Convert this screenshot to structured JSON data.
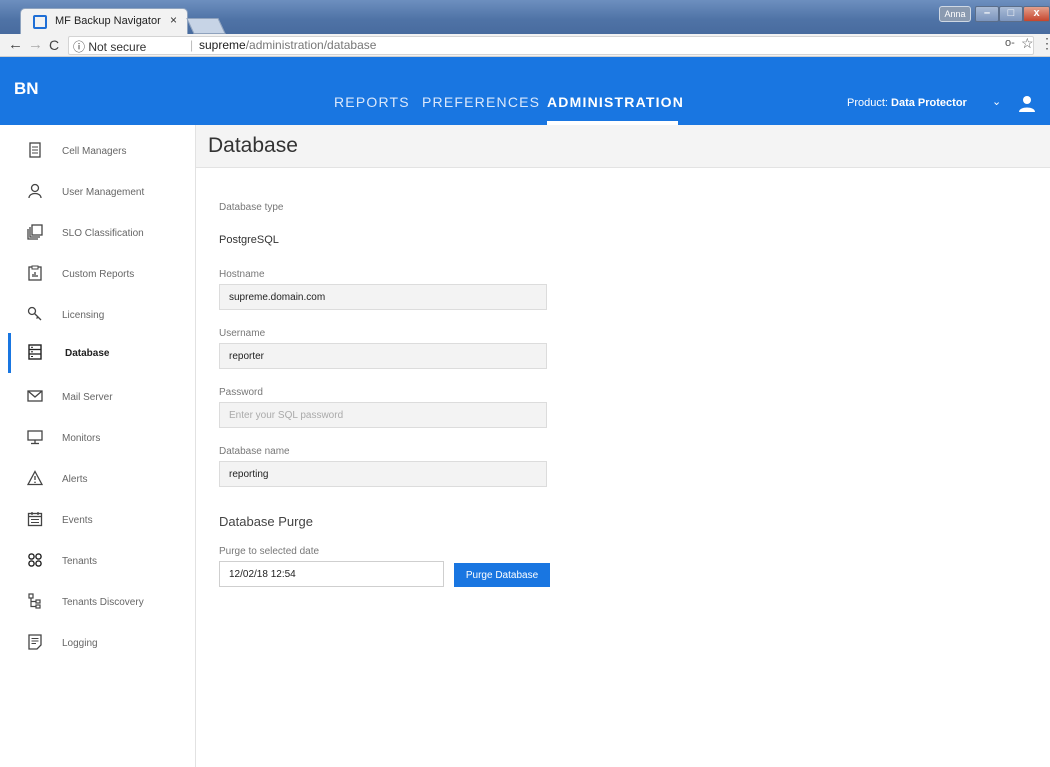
{
  "browser": {
    "tab_title": "MF Backup Navigator",
    "tab_close": "×",
    "user_label": "Anna",
    "security_label": "ⓘ Not secure",
    "url_host": "supreme",
    "url_path": "/administration/database"
  },
  "header": {
    "logo": "BN",
    "nav": [
      "REPORTS",
      "PREFERENCES",
      "ADMINISTRATION"
    ],
    "active_nav": "ADMINISTRATION",
    "product_label": "Product:",
    "product_value": "Data Protector"
  },
  "sidebar": {
    "items": [
      {
        "label": "Cell Managers",
        "icon": "document-icon"
      },
      {
        "label": "User Management",
        "icon": "user-icon"
      },
      {
        "label": "SLO Classification",
        "icon": "layers-icon"
      },
      {
        "label": "Custom Reports",
        "icon": "clipboard-chart-icon"
      },
      {
        "label": "Licensing",
        "icon": "key-icon"
      },
      {
        "label": "Database",
        "icon": "database-icon"
      },
      {
        "label": "Mail Server",
        "icon": "mail-icon"
      },
      {
        "label": "Monitors",
        "icon": "monitor-icon"
      },
      {
        "label": "Alerts",
        "icon": "warning-icon"
      },
      {
        "label": "Events",
        "icon": "calendar-icon"
      },
      {
        "label": "Tenants",
        "icon": "group-icon"
      },
      {
        "label": "Tenants Discovery",
        "icon": "hierarchy-icon"
      },
      {
        "label": "Logging",
        "icon": "log-icon"
      }
    ],
    "active_item": "Database"
  },
  "main": {
    "title": "Database",
    "database_type_label": "Database type",
    "database_type_value": "PostgreSQL",
    "hostname_label": "Hostname",
    "hostname_value": "supreme.domain.com",
    "username_label": "Username",
    "username_value": "reporter",
    "password_label": "Password",
    "password_placeholder": "Enter your SQL password",
    "dbname_label": "Database name",
    "dbname_value": "reporting",
    "purge_heading": "Database Purge",
    "purge_label": "Purge to selected date",
    "purge_date_value": "12/02/18 12:54",
    "purge_button": "Purge Database"
  }
}
